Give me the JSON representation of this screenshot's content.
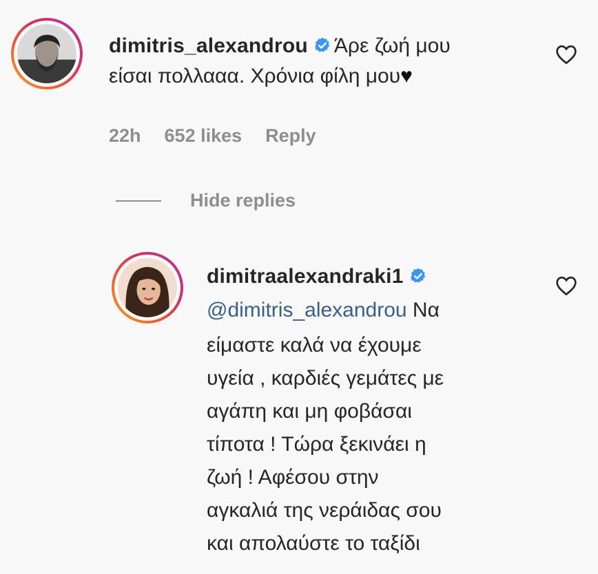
{
  "comment": {
    "username": "dimitris_alexandrou",
    "text_line1": "Άρε ζωή μου",
    "text_line2": "είσαι πολλααα. Χρόνια φίλη μου",
    "heart_glyph": "♥",
    "timestamp": "22h",
    "likes": "652 likes",
    "reply_label": "Reply",
    "verified_icon": "verified-badge-icon",
    "like_icon": "heart-outline-icon"
  },
  "replies_toggle": {
    "label": "Hide replies"
  },
  "reply": {
    "username": "dimitraalexandraki1",
    "mention": "@dimitris_alexandrou",
    "text_after_mention": " Να",
    "lines": [
      "είμαστε καλά να έχουμε",
      "υγεία , καρδιές γεμάτες με",
      "αγάπη και μη φοβάσαι",
      "τίποτα ! Τώρα ξεκινάει η",
      "ζωή ! Αφέσου στην",
      "αγκαλιά της νεράιδας σου",
      "και απολαύστε το ταξίδι"
    ],
    "verified_icon": "verified-badge-icon",
    "like_icon": "heart-outline-icon"
  },
  "colors": {
    "text": "#262626",
    "secondary": "#8e8e8e",
    "mention": "#385f8a",
    "verified": "#3897f0"
  }
}
